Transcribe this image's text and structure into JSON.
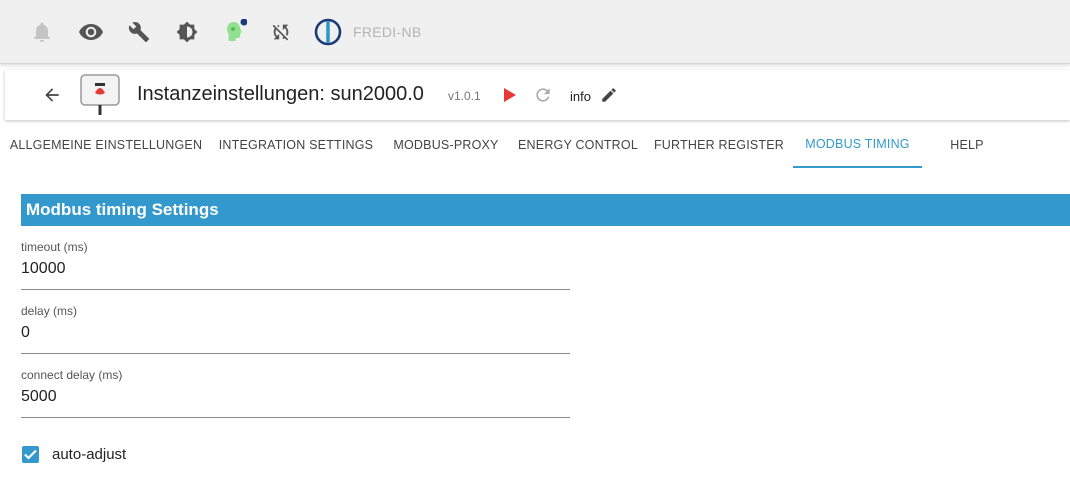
{
  "topbar": {
    "icons": [
      "bell-icon",
      "eye-icon",
      "wrench-icon",
      "brightness-icon",
      "admin-head-icon",
      "sync-disabled-icon",
      "iobroker-logo-icon"
    ],
    "host": "FREDI-NB"
  },
  "header": {
    "title": "Instanzeinstellungen: sun2000.0",
    "version": "v1.0.1",
    "info_label": "info"
  },
  "tabs": [
    {
      "label": "ALLGEMEINE EINSTELLUNGEN"
    },
    {
      "label": "INTEGRATION SETTINGS"
    },
    {
      "label": "MODBUS-PROXY"
    },
    {
      "label": "ENERGY CONTROL"
    },
    {
      "label": "FURTHER REGISTER"
    },
    {
      "label": "MODBUS TIMING",
      "active": true
    },
    {
      "label": "HELP"
    }
  ],
  "section": {
    "title": "Modbus timing Settings",
    "fields": [
      {
        "label": "timeout (ms)",
        "value": "10000"
      },
      {
        "label": "delay (ms)",
        "value": "0"
      },
      {
        "label": "connect delay (ms)",
        "value": "5000"
      }
    ],
    "checkbox": {
      "label": "auto-adjust",
      "checked": true
    }
  },
  "colors": {
    "accent": "#3399cc",
    "play": "#e53935",
    "admin_head": "#8fe08f",
    "notification_dot": "#1a3a7a"
  }
}
